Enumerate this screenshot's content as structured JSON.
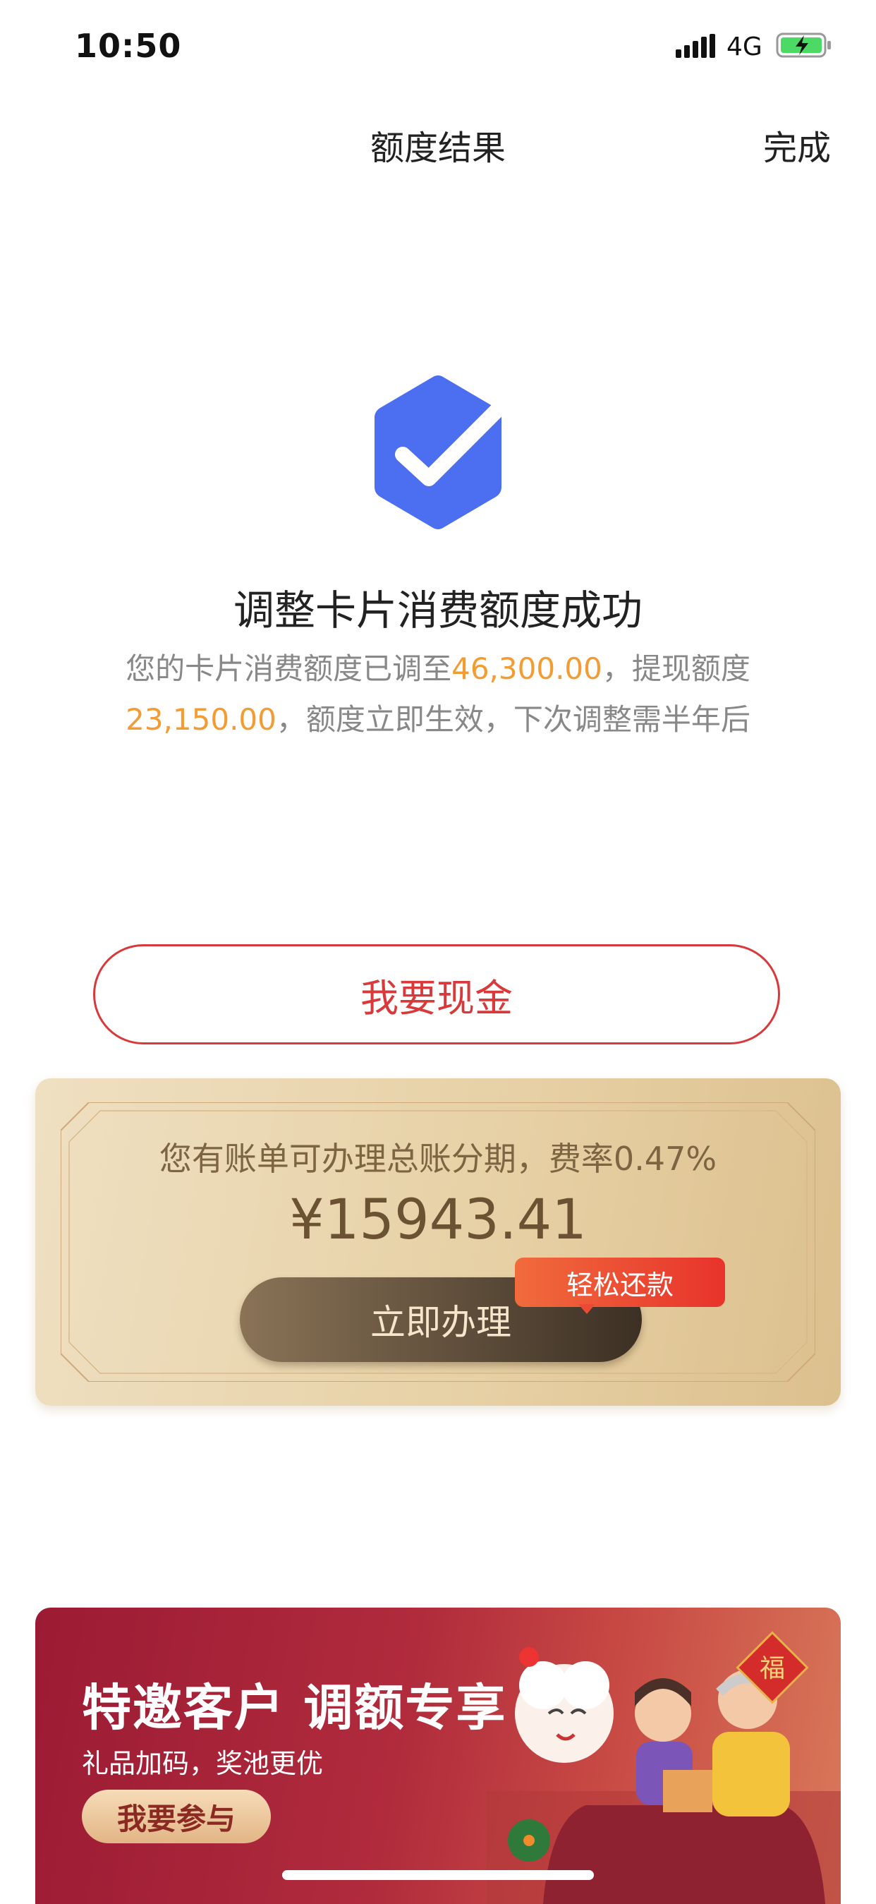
{
  "status_bar": {
    "time": "10:50",
    "network": "4G"
  },
  "nav": {
    "title": "额度结果",
    "done_label": "完成"
  },
  "result": {
    "title": "调整卡片消费额度成功",
    "desc_part1": "您的卡片消费额度已调至",
    "consume_limit": "46,300.00",
    "desc_part2": "，提现额度",
    "cash_limit": "23,150.00",
    "desc_part3": "，额度立即生效，下次调整需半年后"
  },
  "cash_button_label": "我要现金",
  "installment_card": {
    "text": "您有账单可办理总账分期，费率0.47%",
    "amount": "¥15943.41",
    "button_label": "立即办理",
    "badge": "轻松还款"
  },
  "promo_banner": {
    "title": "特邀客户 调额专享",
    "subtitle": "礼品加码，奖池更优",
    "button_label": "我要参与",
    "fu_char": "福"
  },
  "colors": {
    "accent_red": "#d8393a",
    "highlight_orange": "#f29c33",
    "success_blue": "#4c6ef0"
  }
}
